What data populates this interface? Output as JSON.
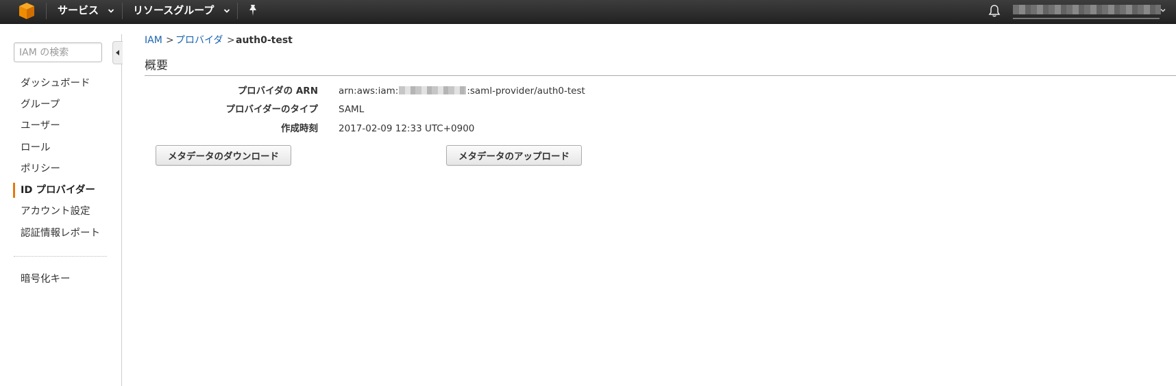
{
  "topnav": {
    "services_label": "サービス",
    "resource_groups_label": "リソースグループ",
    "logo_icon": "aws-cube-icon",
    "pin_icon": "pin-icon",
    "bell_icon": "bell-icon"
  },
  "sidebar": {
    "search_placeholder": "IAM の検索",
    "items": [
      {
        "label": "ダッシュボード"
      },
      {
        "label": "グループ"
      },
      {
        "label": "ユーザー"
      },
      {
        "label": "ロール"
      },
      {
        "label": "ポリシー"
      },
      {
        "label": "ID プロバイダー",
        "active": true
      },
      {
        "label": "アカウント設定"
      },
      {
        "label": "認証情報レポート"
      }
    ],
    "secondary_items": [
      {
        "label": "暗号化キー"
      }
    ],
    "active_color": "#e47911"
  },
  "breadcrumb": {
    "items": [
      "IAM",
      "プロバイダ",
      "auth0-test"
    ],
    "separator": ">"
  },
  "summary": {
    "title": "概要",
    "rows": [
      {
        "label": "プロバイダの ARN",
        "value_prefix": "arn:aws:iam:",
        "value_suffix": ":saml-provider/auth0-test"
      },
      {
        "label": "プロバイダーのタイプ",
        "value": "SAML"
      },
      {
        "label": "作成時刻",
        "value": "2017-02-09 12:33 UTC+0900"
      }
    ],
    "buttons": {
      "download": "メタデータのダウンロード",
      "upload": "メタデータのアップロード"
    }
  },
  "colors": {
    "nav_bg": "#2b2b2b",
    "link": "#1a63b0",
    "logo_orange": "#f90"
  }
}
